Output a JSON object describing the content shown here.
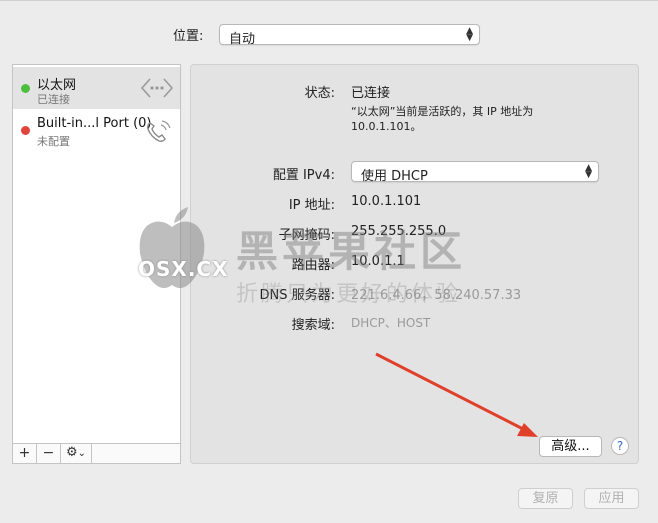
{
  "location": {
    "label": "位置:",
    "value": "自动"
  },
  "sidebar": {
    "items": [
      {
        "name": "以太网",
        "status": "已连接",
        "dot_color": "#4cbf3f",
        "icon": "ethernet-icon"
      },
      {
        "name": "Built-in...l Port (0)",
        "status": "未配置",
        "dot_color": "#e0443a",
        "icon": "phone-icon"
      }
    ],
    "add_label": "+",
    "remove_label": "−",
    "gear_label": "⚙",
    "gear_chevron": "⌄"
  },
  "detail": {
    "status_label": "状态:",
    "status_value": "已连接",
    "status_desc_line1": "“以太网”当前是活跃的，其 IP 地址为",
    "status_desc_line2": "10.0.1.101。",
    "config_label": "配置 IPv4:",
    "config_value": "使用 DHCP",
    "ip_label": "IP 地址:",
    "ip_value": "10.0.1.101",
    "subnet_label": "子网掩码:",
    "subnet_value": "255.255.255.0",
    "router_label": "路由器:",
    "router_value": "10.0.1.1",
    "dns_label": "DNS 服务器:",
    "dns_value": "221.6.4.66，58.240.57.33",
    "search_label": "搜索域:",
    "search_value": "DHCP、HOST"
  },
  "buttons": {
    "advanced": "高级...",
    "help": "?",
    "revert": "复原",
    "apply": "应用"
  },
  "watermark": {
    "site": "OSX.CX",
    "title": "黑苹果社区",
    "slogan": "折腾只为更好的体验"
  },
  "colors": {
    "annotation_arrow": "#e0402a"
  }
}
